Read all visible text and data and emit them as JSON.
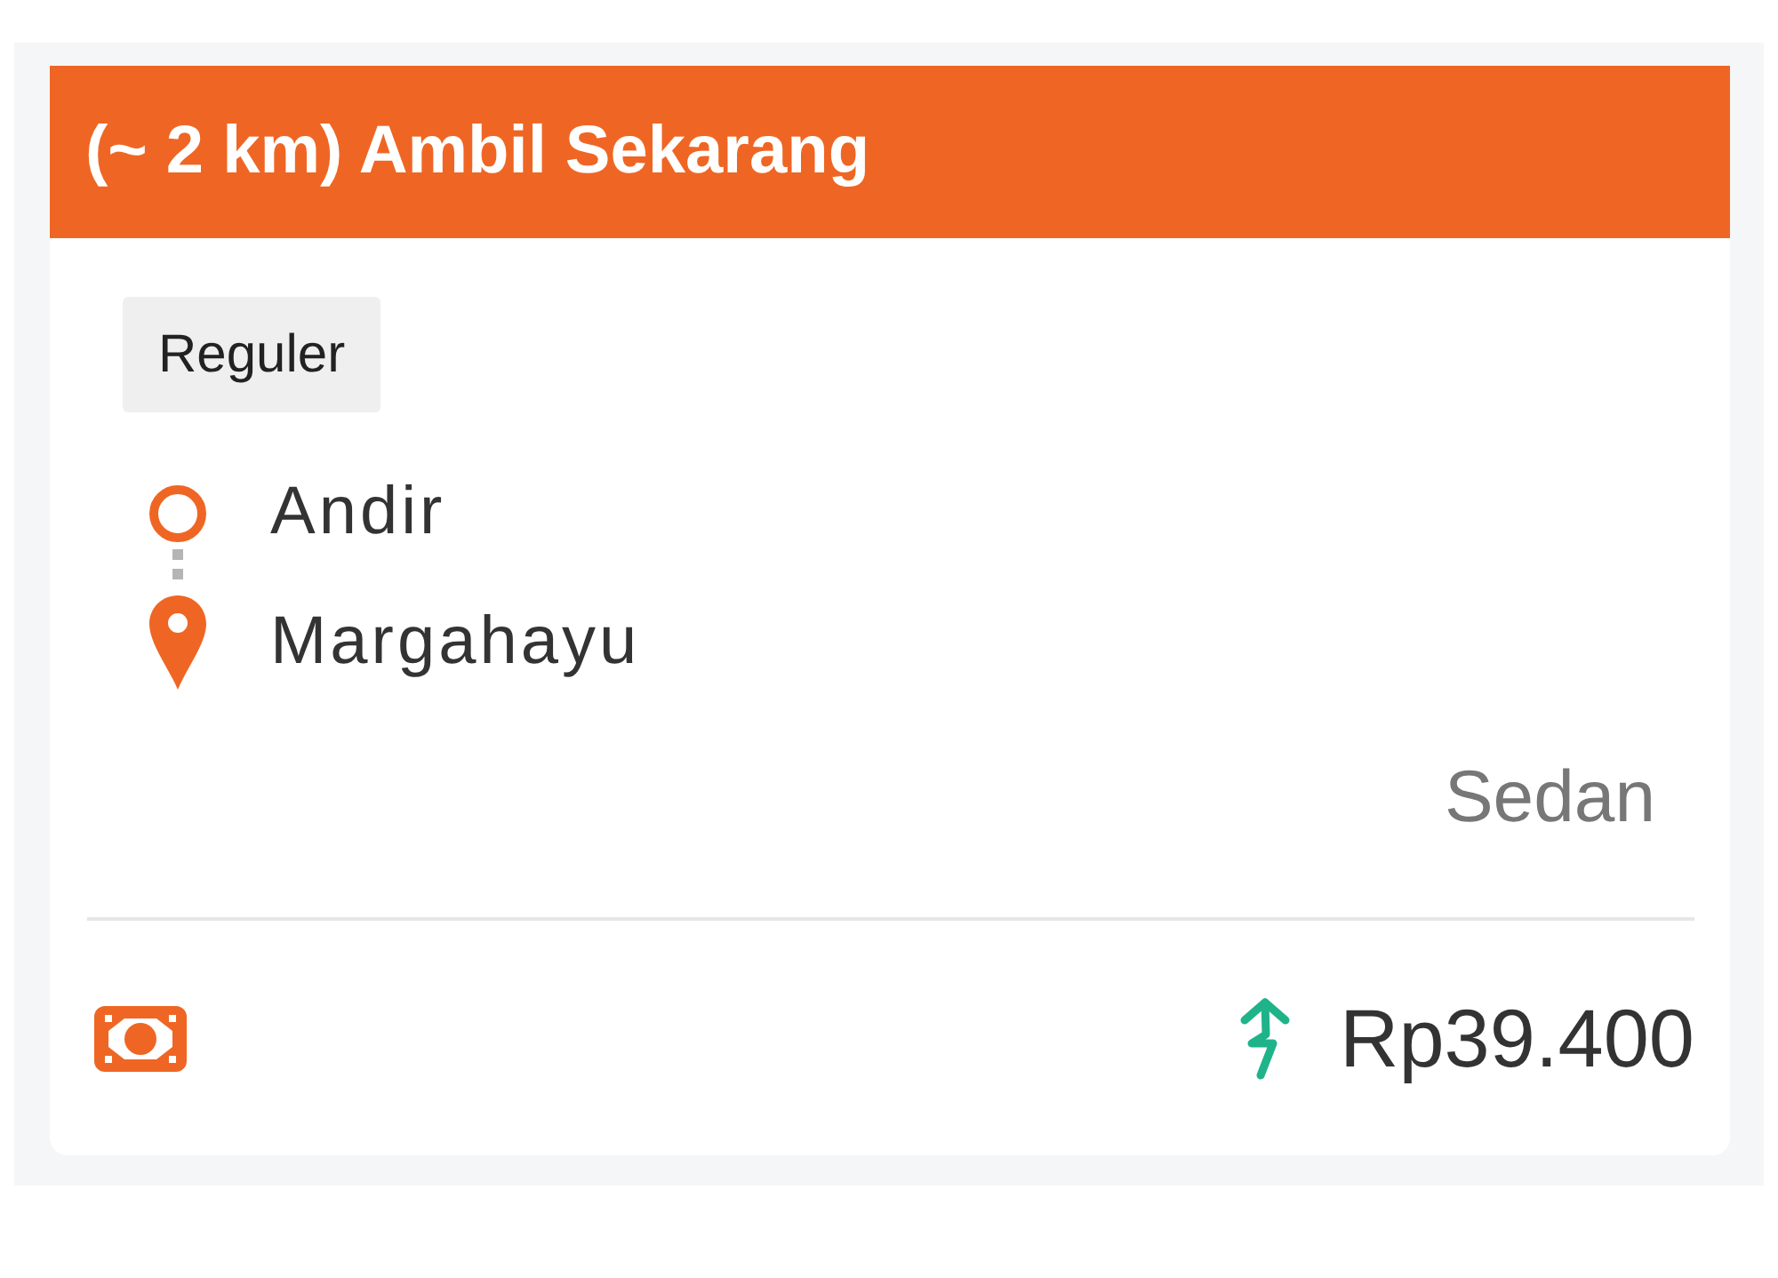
{
  "header": {
    "title": "(~ 2 km) Ambil Sekarang"
  },
  "service_tag": "Reguler",
  "route": [
    {
      "kind": "pickup",
      "name": "Andir"
    },
    {
      "kind": "destination",
      "name": "Margahayu"
    }
  ],
  "vehicle_type": "Sedan",
  "price": {
    "surge": true,
    "amount": "Rp39.400"
  }
}
